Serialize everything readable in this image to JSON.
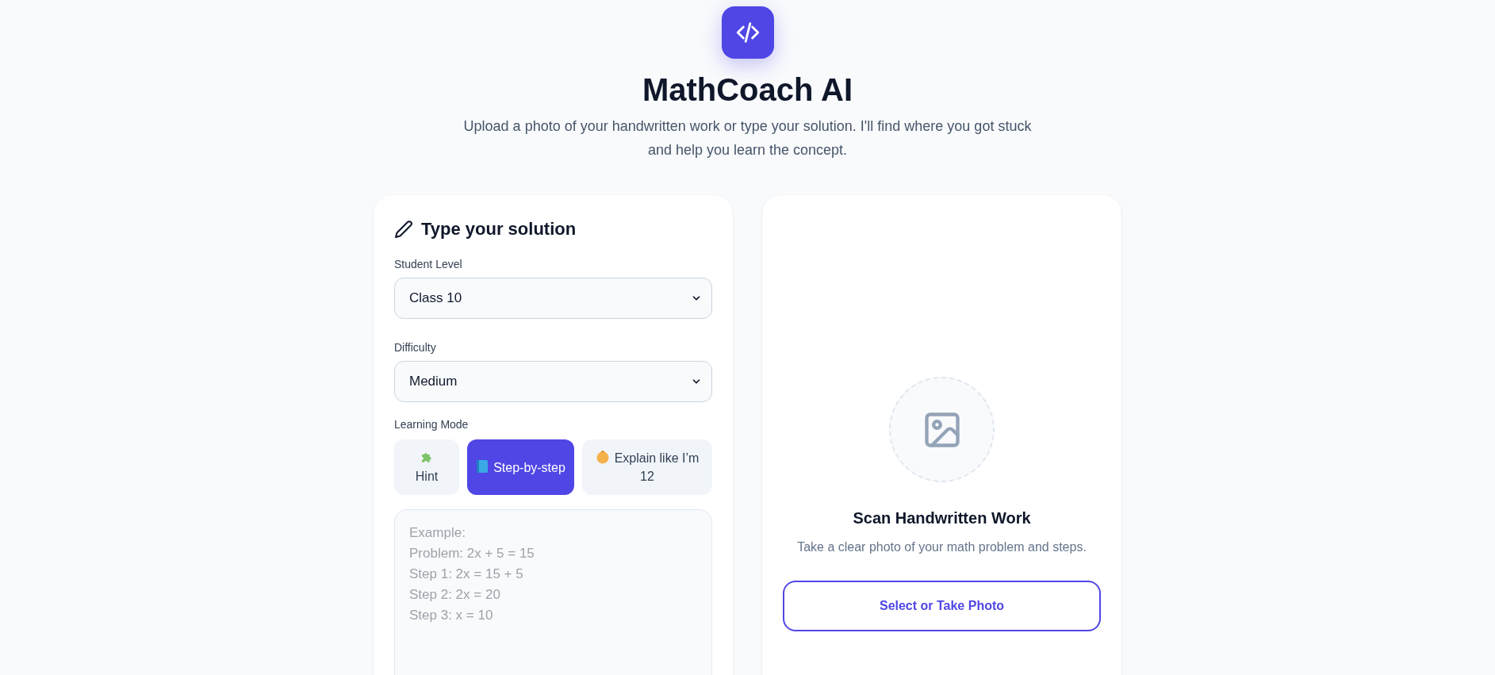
{
  "header": {
    "title": "MathCoach AI",
    "subtitle": "Upload a photo of your handwritten work or type your solution. I'll find where you got stuck and help you learn the concept."
  },
  "solution_card": {
    "title": "Type your solution",
    "fields": [
      {
        "label": "Student Level",
        "value": "Class 10"
      },
      {
        "label": "Difficulty",
        "value": "Medium"
      }
    ],
    "learning_mode": {
      "label": "Learning Mode",
      "options": [
        {
          "kind": "hint",
          "label": "Hint",
          "selected": false
        },
        {
          "kind": "steps",
          "label": "Step-by-step",
          "selected": true
        },
        {
          "kind": "simple",
          "label": "Explain like I’m 12",
          "selected": false
        }
      ]
    },
    "solution_input": {
      "placeholder": "Example:\nProblem: 2x + 5 = 15\nStep 1: 2x = 15 + 5\nStep 2: 2x = 20\nStep 3: x = 10"
    }
  },
  "scan_card": {
    "title": "Scan Handwritten Work",
    "description": "Take a clear photo of your math problem and steps.",
    "button": "Select or Take Photo"
  }
}
